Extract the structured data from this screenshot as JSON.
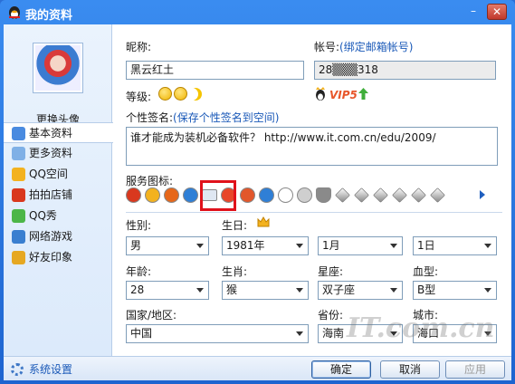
{
  "window": {
    "title": "我的资料",
    "minimize": "–",
    "close": "✕"
  },
  "left": {
    "change_avatar": "更换头像",
    "nav": [
      {
        "label": "基本资料",
        "icon": "profile-card-icon",
        "color": "#4a8be0"
      },
      {
        "label": "更多资料",
        "icon": "more-info-icon",
        "color": "#7fb0e6"
      },
      {
        "label": "QQ空间",
        "icon": "qzone-icon",
        "color": "#f3b21f"
      },
      {
        "label": "拍拍店铺",
        "icon": "paipai-shop-icon",
        "color": "#d9381e"
      },
      {
        "label": "QQ秀",
        "icon": "qqshow-icon",
        "color": "#4cb648"
      },
      {
        "label": "网络游戏",
        "icon": "online-game-icon",
        "color": "#3a7fd0"
      },
      {
        "label": "好友印象",
        "icon": "friend-impression-icon",
        "color": "#e6a822"
      }
    ]
  },
  "main": {
    "nickname_label": "昵称:",
    "nickname_value": "黑云红土",
    "account_label": "帐号:",
    "account_link": "(绑定邮箱帐号)",
    "account_value": "28▒▒▒318",
    "level_label": "等级:",
    "vip_text": "VIP5",
    "signature_label": "个性签名:",
    "signature_link": "(保存个性签名到空间)",
    "signature_value": "谁才能成为装机必备软件？ http://www.it.com.cn/edu/2009/",
    "service_label": "服务图标:",
    "service_icons": [
      "qq-penguin-icon",
      "qzone-star-icon",
      "paipai-icon",
      "qq-music-icon",
      "qq-mail-icon",
      "heart-icon",
      "home-icon",
      "photo-icon",
      "love-icon",
      "gold-coin-icon",
      "shield-icon",
      "gem-icon",
      "gem-icon",
      "gem-icon",
      "gem-icon",
      "gem-icon",
      "gem-icon"
    ],
    "gender_label": "性别:",
    "gender_value": "男",
    "birthday_label": "生日:",
    "birth_year": "1981年",
    "birth_month": "1月",
    "birth_day": "1日",
    "age_label": "年龄:",
    "age_value": "28",
    "zodiac_label": "生肖:",
    "zodiac_value": "猴",
    "constellation_label": "星座:",
    "constellation_value": "双子座",
    "blood_label": "血型:",
    "blood_value": "B型",
    "country_label": "国家/地区:",
    "country_value": "中国",
    "province_label": "省份:",
    "province_value": "海南",
    "city_label": "城市:",
    "city_value": "海口"
  },
  "bottom": {
    "settings": "系统设置",
    "ok": "确定",
    "cancel": "取消",
    "apply": "应用"
  },
  "watermark": "IT.com.cn",
  "colors": {
    "link": "#1a59b8",
    "titlebar": "#2b6fd6",
    "highlight": "#e0121b"
  }
}
